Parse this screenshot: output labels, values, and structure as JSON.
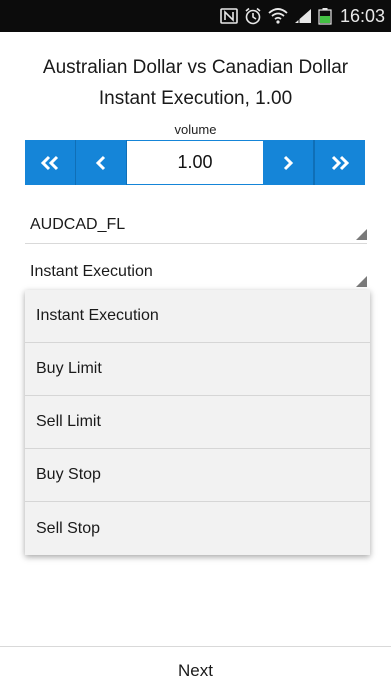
{
  "status_bar": {
    "time": "16:03",
    "icons": [
      "nfc-icon",
      "alarm-icon",
      "wifi-icon",
      "signal-icon",
      "battery-icon"
    ]
  },
  "header": {
    "title_line1": "Australian Dollar vs Canadian Dollar",
    "title_line2": "Instant Execution, 1.00"
  },
  "volume": {
    "label": "volume",
    "value": "1.00",
    "buttons": [
      "fast-decrease",
      "decrease",
      "increase",
      "fast-increase"
    ]
  },
  "symbol_select": {
    "value": "AUDCAD_FL"
  },
  "type_select": {
    "value": "Instant Execution"
  },
  "dropdown": {
    "options": [
      "Instant Execution",
      "Buy Limit",
      "Sell Limit",
      "Buy Stop",
      "Sell Stop"
    ]
  },
  "footer": {
    "next_label": "Next"
  },
  "colors": {
    "accent": "#1585d8",
    "status_bar_bg": "#0c0c0c",
    "corner_accent": "#e0463c"
  }
}
